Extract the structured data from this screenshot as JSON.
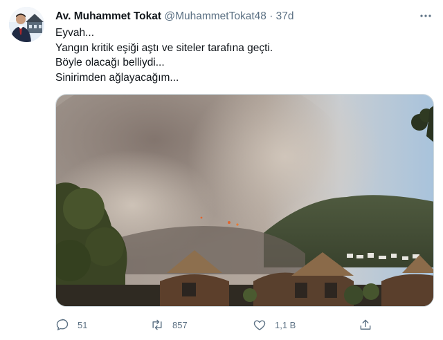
{
  "tweet": {
    "author_name": "Av. Muhammet Tokat",
    "handle": "@MuhammetTokat48",
    "separator": "·",
    "age": "37d",
    "lines": [
      "Eyvah...",
      "Yangın kritik eşiği aştı ve siteler tarafına geçti.",
      "Böyle olacağı belliydi...",
      "Sinirimden ağlayacağım..."
    ],
    "media_icon": "wildfire-smoke-photo",
    "actions": {
      "reply_count": "51",
      "retweet_count": "857",
      "like_count": "1,1 B"
    }
  },
  "colors": {
    "secondary_text": "#5b7083",
    "primary_text": "#0f1419",
    "border": "#cfd9de"
  }
}
